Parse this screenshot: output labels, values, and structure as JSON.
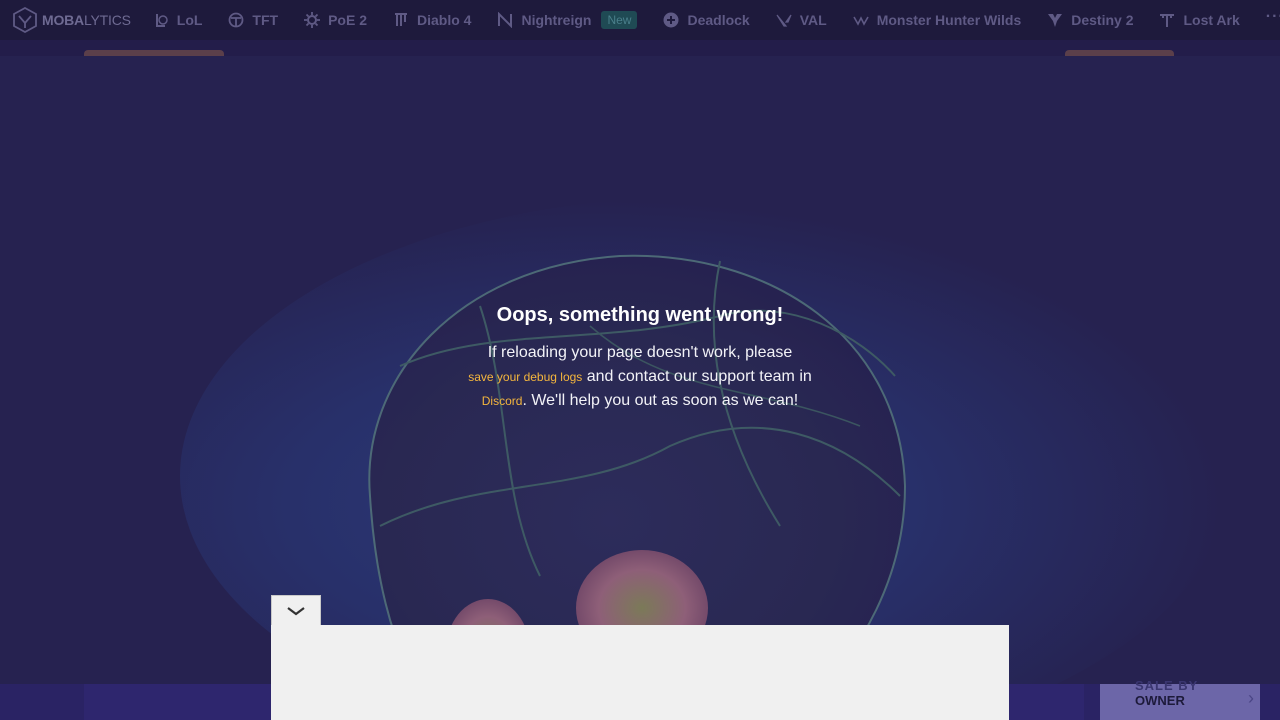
{
  "brand": {
    "name_bold": "MOBA",
    "name_light": "LYTICS",
    "logo_icon": "mobalytics-shield-icon"
  },
  "nav": {
    "items": [
      {
        "label": "LoL",
        "icon": "lol-icon"
      },
      {
        "label": "TFT",
        "icon": "tft-icon"
      },
      {
        "label": "PoE 2",
        "icon": "poe2-icon"
      },
      {
        "label": "Diablo 4",
        "icon": "diablo4-icon"
      },
      {
        "label": "Nightreign",
        "icon": "nightreign-icon",
        "badge": "New"
      },
      {
        "label": "Deadlock",
        "icon": "deadlock-icon"
      },
      {
        "label": "VAL",
        "icon": "valorant-icon"
      },
      {
        "label": "Monster Hunter Wilds",
        "icon": "monster-hunter-icon"
      },
      {
        "label": "Destiny 2",
        "icon": "destiny2-icon"
      },
      {
        "label": "Lost Ark",
        "icon": "lost-ark-icon"
      }
    ],
    "more": "···"
  },
  "error": {
    "title": "Oops, something went wrong!",
    "line1": "If reloading your page doesn't work, please",
    "debug_link": "save your debug logs",
    "line2_mid": " and contact our support team in",
    "discord_link": "Discord",
    "line3_end": ". We'll help you out as soon as we can!"
  },
  "footer": {
    "owner_top": "SALE BY",
    "owner_label": "OWNER",
    "chevron": "›"
  },
  "ad": {
    "toggle_icon": "chevron-down-icon"
  },
  "colors": {
    "nav_bg": "#1e1a3c",
    "overlay_bg": "#262250",
    "link": "#f5b63d",
    "badge_bg": "#1f4a54"
  }
}
